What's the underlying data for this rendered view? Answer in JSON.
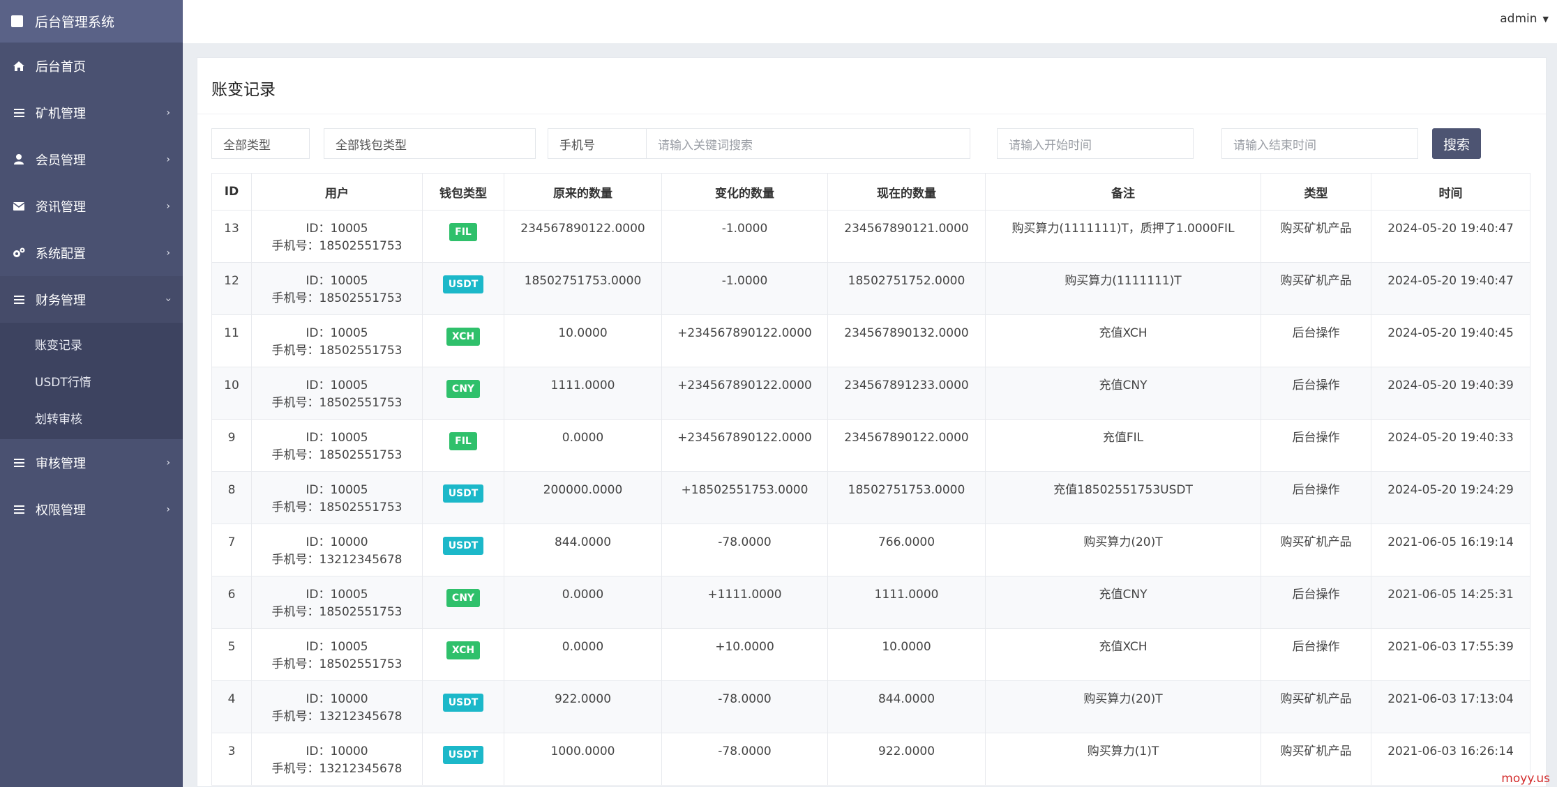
{
  "app": {
    "title": "后台管理系统"
  },
  "topbar": {
    "user": "admin"
  },
  "sidebar": {
    "items": [
      {
        "label": "后台首页",
        "icon": "home-icon"
      },
      {
        "label": "矿机管理",
        "icon": "list-icon"
      },
      {
        "label": "会员管理",
        "icon": "user-icon"
      },
      {
        "label": "资讯管理",
        "icon": "envelope-icon"
      },
      {
        "label": "系统配置",
        "icon": "gears-icon"
      },
      {
        "label": "财务管理",
        "icon": "list-icon",
        "open": true
      },
      {
        "label": "审核管理",
        "icon": "list-icon"
      },
      {
        "label": "权限管理",
        "icon": "list-icon"
      }
    ],
    "submenu": [
      "账变记录",
      "USDT行情",
      "划转审核"
    ]
  },
  "page": {
    "title": "账变记录"
  },
  "filters": {
    "type_select": "全部类型",
    "wallet_select": "全部钱包类型",
    "field_select": "手机号",
    "keyword_placeholder": "请输入关键词搜索",
    "start_placeholder": "请输入开始时间",
    "end_placeholder": "请输入结束时间",
    "search_label": "搜索"
  },
  "table": {
    "headers": [
      "ID",
      "用户",
      "钱包类型",
      "原来的数量",
      "变化的数量",
      "现在的数量",
      "备注",
      "类型",
      "时间"
    ],
    "rows": [
      {
        "id": "13",
        "user_id": "ID：10005",
        "phone": "手机号：18502551753",
        "wallet": "FIL",
        "before": "234567890122.0000",
        "change": "-1.0000",
        "after": "234567890121.0000",
        "note": "购买算力(1111111)T，质押了1.0000FIL",
        "type": "购买矿机产品",
        "time": "2024-05-20 19:40:47"
      },
      {
        "id": "12",
        "user_id": "ID：10005",
        "phone": "手机号：18502551753",
        "wallet": "USDT",
        "before": "18502751753.0000",
        "change": "-1.0000",
        "after": "18502751752.0000",
        "note": "购买算力(1111111)T",
        "type": "购买矿机产品",
        "time": "2024-05-20 19:40:47"
      },
      {
        "id": "11",
        "user_id": "ID：10005",
        "phone": "手机号：18502551753",
        "wallet": "XCH",
        "before": "10.0000",
        "change": "+234567890122.0000",
        "after": "234567890132.0000",
        "note": "充值XCH",
        "type": "后台操作",
        "time": "2024-05-20 19:40:45"
      },
      {
        "id": "10",
        "user_id": "ID：10005",
        "phone": "手机号：18502551753",
        "wallet": "CNY",
        "before": "1111.0000",
        "change": "+234567890122.0000",
        "after": "234567891233.0000",
        "note": "充值CNY",
        "type": "后台操作",
        "time": "2024-05-20 19:40:39"
      },
      {
        "id": "9",
        "user_id": "ID：10005",
        "phone": "手机号：18502551753",
        "wallet": "FIL",
        "before": "0.0000",
        "change": "+234567890122.0000",
        "after": "234567890122.0000",
        "note": "充值FIL",
        "type": "后台操作",
        "time": "2024-05-20 19:40:33"
      },
      {
        "id": "8",
        "user_id": "ID：10005",
        "phone": "手机号：18502551753",
        "wallet": "USDT",
        "before": "200000.0000",
        "change": "+18502551753.0000",
        "after": "18502751753.0000",
        "note": "充值18502551753USDT",
        "type": "后台操作",
        "time": "2024-05-20 19:24:29"
      },
      {
        "id": "7",
        "user_id": "ID：10000",
        "phone": "手机号：13212345678",
        "wallet": "USDT",
        "before": "844.0000",
        "change": "-78.0000",
        "after": "766.0000",
        "note": "购买算力(20)T",
        "type": "购买矿机产品",
        "time": "2021-06-05 16:19:14"
      },
      {
        "id": "6",
        "user_id": "ID：10005",
        "phone": "手机号：18502551753",
        "wallet": "CNY",
        "before": "0.0000",
        "change": "+1111.0000",
        "after": "1111.0000",
        "note": "充值CNY",
        "type": "后台操作",
        "time": "2021-06-05 14:25:31"
      },
      {
        "id": "5",
        "user_id": "ID：10005",
        "phone": "手机号：18502551753",
        "wallet": "XCH",
        "before": "0.0000",
        "change": "+10.0000",
        "after": "10.0000",
        "note": "充值XCH",
        "type": "后台操作",
        "time": "2021-06-03 17:55:39"
      },
      {
        "id": "4",
        "user_id": "ID：10000",
        "phone": "手机号：13212345678",
        "wallet": "USDT",
        "before": "922.0000",
        "change": "-78.0000",
        "after": "844.0000",
        "note": "购买算力(20)T",
        "type": "购买矿机产品",
        "time": "2021-06-03 17:13:04"
      },
      {
        "id": "3",
        "user_id": "ID：10000",
        "phone": "手机号：13212345678",
        "wallet": "USDT",
        "before": "1000.0000",
        "change": "-78.0000",
        "after": "922.0000",
        "note": "购买算力(1)T",
        "type": "购买矿机产品",
        "time": "2021-06-03 16:26:14"
      }
    ]
  },
  "badge_colors": {
    "FIL": "#2fc06b",
    "USDT": "#1cb8c9",
    "XCH": "#2fc06b",
    "CNY": "#2fc06b"
  },
  "watermark": "moyy.us"
}
